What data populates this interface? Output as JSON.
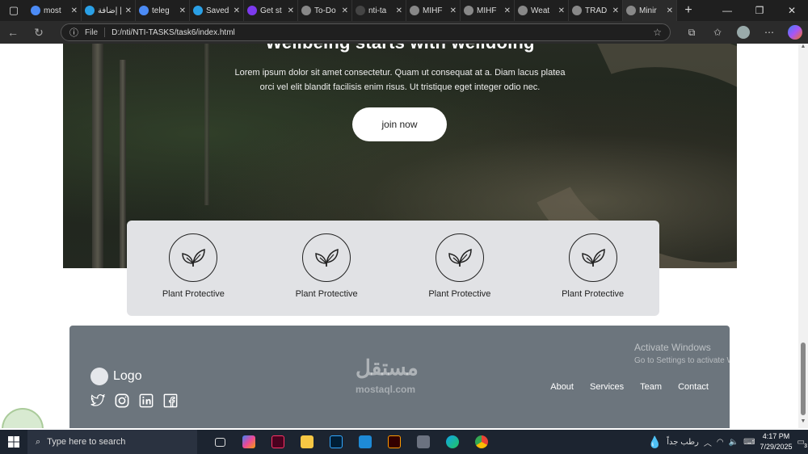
{
  "browser": {
    "tabs": [
      {
        "title": "most",
        "icon": "search-icon",
        "color": "#4c8bf5"
      },
      {
        "title": "إضافة |",
        "icon": "mostaql-icon",
        "color": "#2aa0e6"
      },
      {
        "title": "teleg",
        "icon": "search-icon",
        "color": "#4c8bf5"
      },
      {
        "title": "Saved",
        "icon": "telegram-icon",
        "color": "#2aa0e6"
      },
      {
        "title": "Get st",
        "icon": "bootstrap-icon",
        "color": "#7c3aed"
      },
      {
        "title": "To-Do",
        "icon": "globe-icon",
        "color": "#888888"
      },
      {
        "title": "nti-ta",
        "icon": "github-icon",
        "color": "#444444"
      },
      {
        "title": "MIHF",
        "icon": "globe-icon",
        "color": "#888888"
      },
      {
        "title": "MIHF",
        "icon": "globe-icon",
        "color": "#888888"
      },
      {
        "title": "Weat",
        "icon": "globe-icon",
        "color": "#888888"
      },
      {
        "title": "TRAD",
        "icon": "globe-icon",
        "color": "#888888"
      },
      {
        "title": "Minir",
        "icon": "globe-icon",
        "color": "#888888",
        "active": true
      }
    ],
    "address": {
      "scheme_label": "File",
      "url": "D:/nti/NTI-TASKS/task6/index.html"
    }
  },
  "hero": {
    "title": "Wellbeing starts with welldoing",
    "text": "Lorem ipsum dolor sit amet consectetur. Quam ut consequat at a. Diam lacus platea orci vel elit blandit facilisis enim risus. Ut tristique eget integer odio nec.",
    "cta": "join now"
  },
  "features": [
    {
      "label": "Plant Protective",
      "icon": "plant-leaves-icon"
    },
    {
      "label": "Plant Protective",
      "icon": "plant-leaves-icon"
    },
    {
      "label": "Plant Protective",
      "icon": "plant-leaves-icon"
    },
    {
      "label": "Plant Protective",
      "icon": "plant-leaves-icon"
    }
  ],
  "footer": {
    "logo": "Logo",
    "social": [
      "twitter-icon",
      "instagram-icon",
      "linkedin-icon",
      "facebook-icon"
    ],
    "nav": [
      "About",
      "Services",
      "Team",
      "Contact"
    ]
  },
  "overlays": {
    "activate_title": "Activate Windows",
    "activate_sub": "Go to Settings to activate Windows.",
    "watermark_ar": "مستقل",
    "watermark_en": "mostaql.com"
  },
  "taskbar": {
    "search_placeholder": "Type here to search",
    "weather": "رطب جداً",
    "time": "4:17 PM",
    "date": "7/29/2025",
    "notifications": "3"
  },
  "colors": {
    "footer_bg": "#6c757d",
    "features_bg": "#e1e2e5",
    "tab_bg": "#1f1f1f"
  }
}
